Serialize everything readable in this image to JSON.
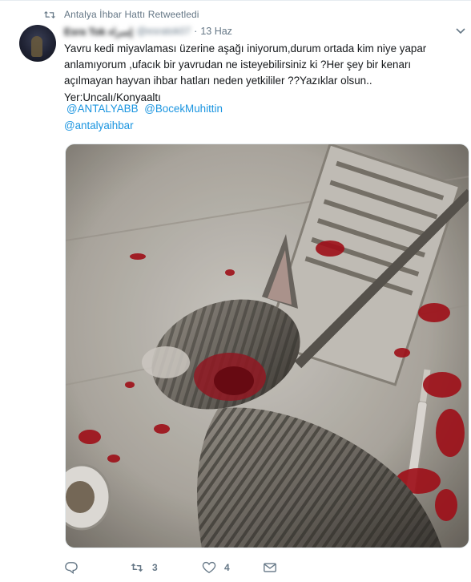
{
  "retweet_context": {
    "text": "Antalya İhbar Hattı Retweetledi"
  },
  "tweet": {
    "author_name": "Esra Tok إسراء",
    "author_handle": "@esratok07",
    "separator": "·",
    "date": "13 Haz",
    "text_lines": [
      "Yavru kedi miyavlaması üzerine aşağı iniyorum,durum ortada kim niye yapar",
      "anlamıyorum ,ufacık bir yavrudan ne isteyebilirsiniz ki ?Her şey bir kenarı",
      "açılmayan hayvan ihbar hatları neden yetkililer ??Yazıklar olsun..",
      "Yer:Uncalı/Konyaaltı"
    ],
    "mentions": [
      "@ANTALYABB",
      "@BocekMuhittin"
    ],
    "mention_2": "@antalyaihbar"
  },
  "actions": {
    "reply_count": "",
    "retweet_count": "3",
    "like_count": "4"
  },
  "colors": {
    "link": "#1b95e0",
    "muted": "#657786"
  },
  "icons": {
    "retweet_context": "retweet-icon",
    "menu": "chevron-down-icon",
    "reply": "reply-icon",
    "retweet": "retweet-icon",
    "like": "heart-icon",
    "dm": "envelope-icon"
  }
}
